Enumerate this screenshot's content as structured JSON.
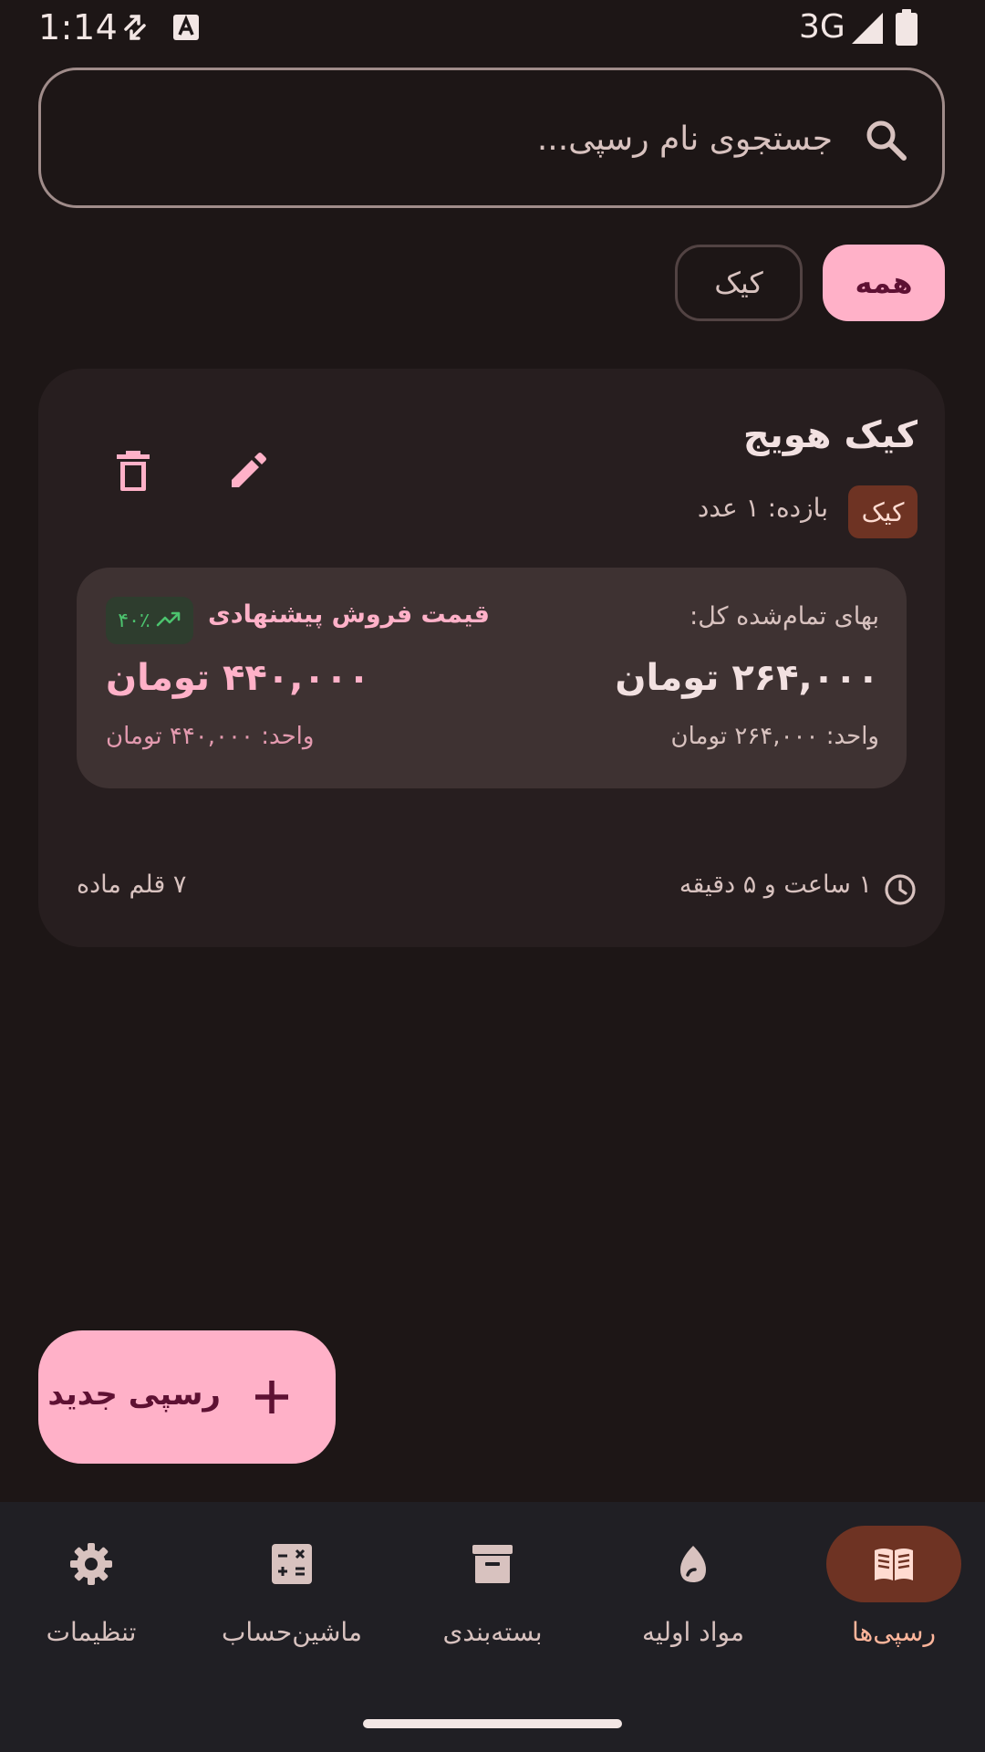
{
  "status_bar": {
    "time": "1:14",
    "network": "3G",
    "icons": [
      "screen-rotate-icon",
      "keyboard-a-icon",
      "signal-icon",
      "battery-icon"
    ]
  },
  "search": {
    "placeholder": "جستجوی نام رسپی...",
    "value": ""
  },
  "filters": {
    "chips": [
      {
        "label": "همه",
        "selected": true
      },
      {
        "label": "کیک",
        "selected": false
      }
    ]
  },
  "recipe": {
    "title": "کیک هویج",
    "category": "کیک",
    "yield": "بازده: ۱ عدد",
    "cost_label": "بهای تمام‌شده کل:",
    "cost_total": "۲۶۴,۰۰۰ تومان",
    "cost_unit": "واحد: ۲۶۴,۰۰۰ تومان",
    "suggested_label": "قیمت فروش پیشنهادی",
    "margin": "۴۰٪",
    "suggested_total": "۴۴۰,۰۰۰ تومان",
    "suggested_unit": "واحد: ۴۴۰,۰۰۰ تومان",
    "duration": "۱ ساعت و ۵ دقیقه",
    "ingredient_count": "۷ قلم ماده"
  },
  "fab": {
    "label": "رسپی جدید"
  },
  "nav": {
    "items": [
      {
        "label": "رسپی‌ها",
        "icon": "book-icon",
        "active": true
      },
      {
        "label": "مواد اولیه",
        "icon": "egg-icon",
        "active": false
      },
      {
        "label": "بسته‌بندی",
        "icon": "archive-box-icon",
        "active": false
      },
      {
        "label": "ماشین‌حساب",
        "icon": "calculator-icon",
        "active": false
      },
      {
        "label": "تنظیمات",
        "icon": "gear-icon",
        "active": false
      }
    ]
  },
  "colors": {
    "background": "#1D1616",
    "card": "#271E1F",
    "price_panel": "#3E3232",
    "primary_pink": "#FFB1C8",
    "badge_brown": "#6E3323",
    "nav_background": "#201F24",
    "green_margin": "#4CC36E"
  }
}
